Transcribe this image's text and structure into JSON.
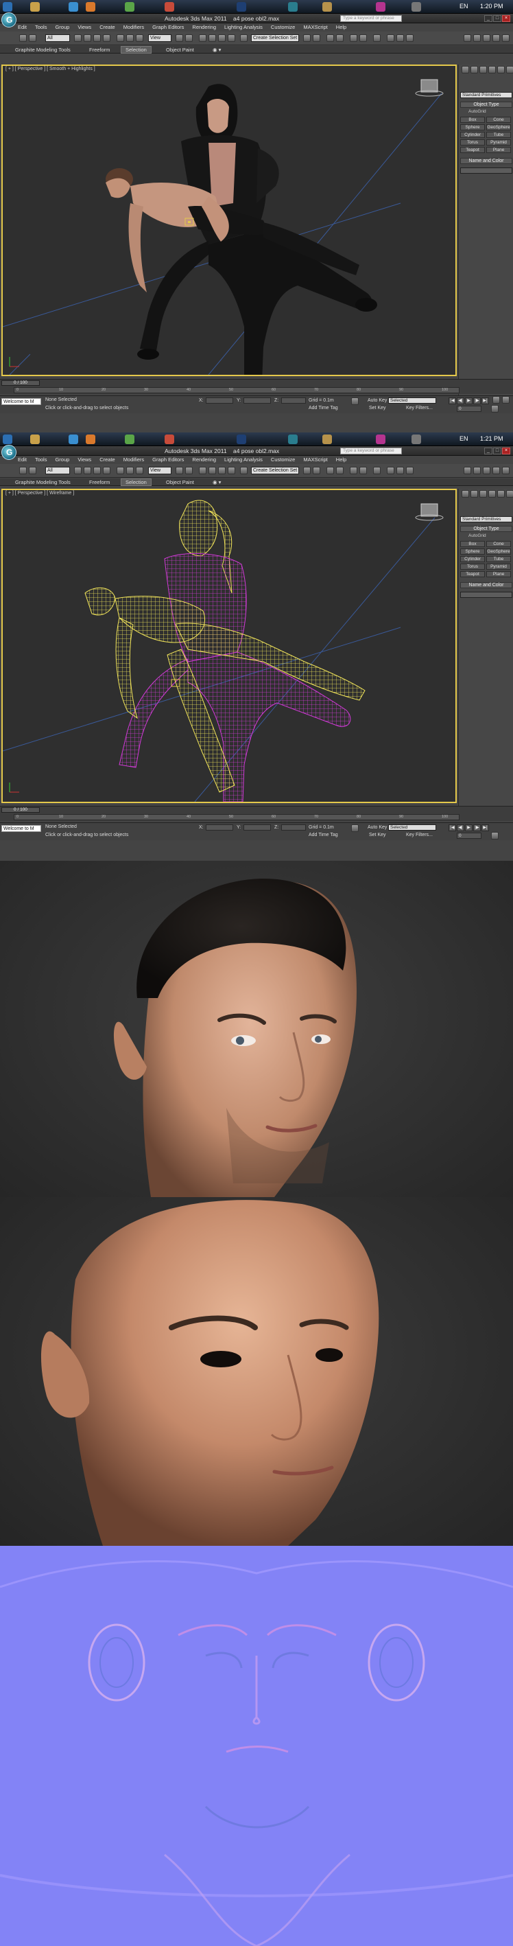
{
  "app": {
    "title": "Autodesk 3ds Max 2011",
    "file": "a4 pose obl2.max",
    "search_placeholder": "Type a keyword or phrase",
    "logo_letter": "G"
  },
  "os": {
    "language": "EN",
    "clock_top": "1:20 PM",
    "clock_mid": "1:21 PM"
  },
  "menu": [
    "Edit",
    "Tools",
    "Group",
    "Views",
    "Create",
    "Modifiers",
    "Graph Editors",
    "Rendering",
    "Lighting Analysis",
    "Customize",
    "MAXScript",
    "Help"
  ],
  "toolbar": {
    "selection_filter": "All",
    "reference_coord": "View",
    "named_selection": "Create Selection Set"
  },
  "ribbon": {
    "tabs": [
      "Graphite Modeling Tools",
      "Freeform",
      "Selection",
      "Object Paint"
    ]
  },
  "viewport_top": {
    "label": "[ + ] [ Perspective ] [ Smooth + Highlights ]"
  },
  "viewport_bottom": {
    "label": "[ + ] [ Perspective ] [ Wireframe ]"
  },
  "command_panel": {
    "dropdown": "Standard Primitives",
    "object_type": "Object Type",
    "autogrid": "AutoGrid",
    "buttons": [
      "Box",
      "Cone",
      "Sphere",
      "GeoSphere",
      "Cylinder",
      "Tube",
      "Torus",
      "Pyramid",
      "Teapot",
      "Plane"
    ],
    "name_and_color": "Name and Color"
  },
  "timeline": {
    "slider": "0 / 100",
    "ticks": [
      "0",
      "5",
      "10",
      "15",
      "20",
      "25",
      "30",
      "35",
      "40",
      "45",
      "50",
      "55",
      "60",
      "65",
      "70",
      "75",
      "80",
      "85",
      "90",
      "95",
      "100"
    ]
  },
  "status": {
    "maxscript": "Welcome to M",
    "selection": "None Selected",
    "prompt": "Click or click-and-drag to select objects",
    "x_label": "X:",
    "y_label": "Y:",
    "z_label": "Z:",
    "grid": "Grid = 0.1m",
    "auto_key": "Auto Key",
    "auto_key_mode": "Selected",
    "set_key": "Set Key",
    "key_filters": "Key Filters...",
    "add_time_tag": "Add Time Tag",
    "frame": "0"
  },
  "colors": {
    "viewport_border": "#e5c94b",
    "viewport_bg": "#2f2f2f",
    "wire_yellow": "#f2e55a",
    "wire_magenta": "#d23ad8",
    "normal_map": "#8383f6"
  }
}
